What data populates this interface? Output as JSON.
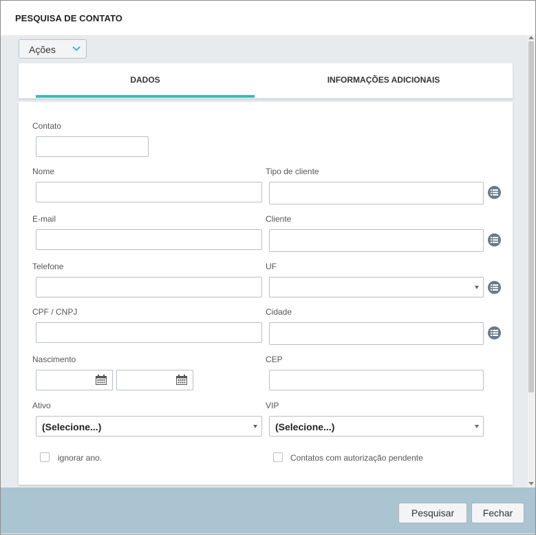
{
  "window": {
    "title": "PESQUISA DE CONTATO"
  },
  "actions_menu": {
    "label": "Ações"
  },
  "tabs": [
    {
      "label": "DADOS",
      "active": true
    },
    {
      "label": "INFORMAÇÕES ADICIONAIS",
      "active": false
    }
  ],
  "form": {
    "contato": {
      "label": "Contato",
      "value": ""
    },
    "nome": {
      "label": "Nome",
      "value": ""
    },
    "tipo_cliente": {
      "label": "Tipo de cliente",
      "value": ""
    },
    "email": {
      "label": "E-mail",
      "value": ""
    },
    "cliente": {
      "label": "Cliente",
      "value": ""
    },
    "telefone": {
      "label": "Telefone",
      "value": ""
    },
    "uf": {
      "label": "UF",
      "value": ""
    },
    "cpf_cnpj": {
      "label": "CPF / CNPJ",
      "value": ""
    },
    "cidade": {
      "label": "Cidade",
      "value": ""
    },
    "nascimento": {
      "label": "Nascimento",
      "from": "",
      "to": ""
    },
    "cep": {
      "label": "CEP",
      "value": ""
    },
    "ativo": {
      "label": "Ativo",
      "value": "(Selecione...)"
    },
    "vip": {
      "label": "VIP",
      "value": "(Selecione...)"
    },
    "ignorar_ano": {
      "label": "ignorar ano.",
      "checked": false
    },
    "autorizacao_pendente": {
      "label": "Contatos com autorização pendente",
      "checked": false
    }
  },
  "footer": {
    "search_label": "Pesquisar",
    "close_label": "Fechar"
  },
  "colors": {
    "accent": "#3fbab6",
    "footer_bg": "#aac4d2",
    "body_bg": "#e8ebee",
    "icon_bg": "#6b7a88"
  }
}
